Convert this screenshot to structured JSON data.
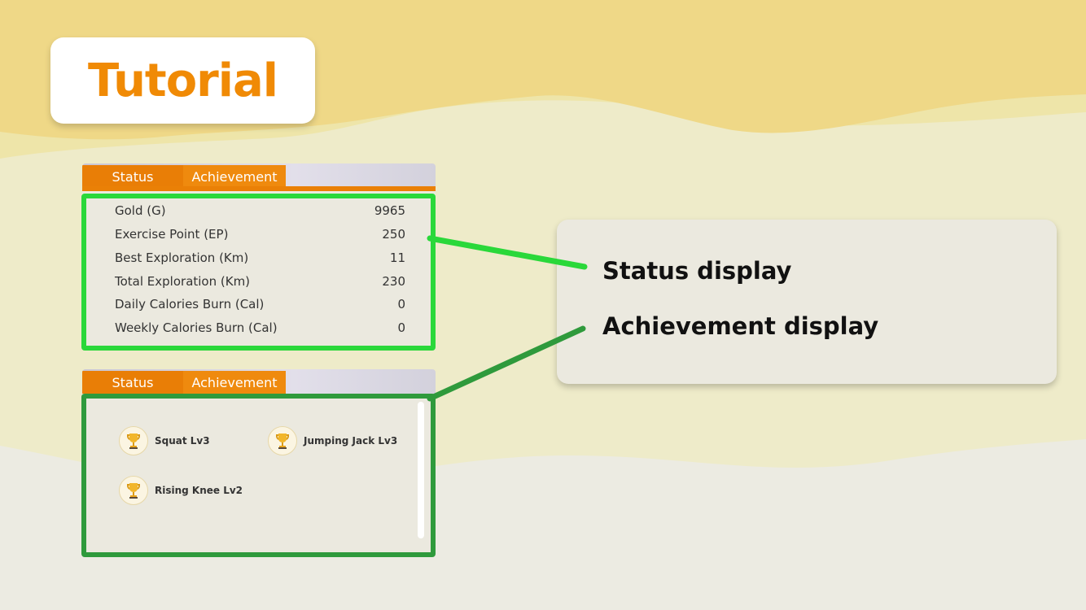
{
  "title": "Tutorial",
  "colors": {
    "title_orange": "#f08a05",
    "tab_orange": "#e97e06",
    "highlight_bright_green": "#2ad83a",
    "highlight_dark_green": "#2f9a3c",
    "panel_bg": "#ebe9df",
    "bg_top_yellow": "#efd887"
  },
  "status_panel": {
    "tabs": [
      "Status",
      "Achievement"
    ],
    "rows": [
      {
        "label": "Gold (G)",
        "value": "9965"
      },
      {
        "label": "Exercise Point (EP)",
        "value": "250"
      },
      {
        "label": "Best Exploration (Km)",
        "value": "11"
      },
      {
        "label": "Total Exploration (Km)",
        "value": "230"
      },
      {
        "label": "Daily Calories Burn (Cal)",
        "value": "0"
      },
      {
        "label": "Weekly Calories Burn (Cal)",
        "value": "0"
      }
    ]
  },
  "achievement_panel": {
    "tabs": [
      "Status",
      "Achievement"
    ],
    "items": [
      {
        "label": "Squat Lv3",
        "icon": "trophy-icon"
      },
      {
        "label": "Jumping Jack Lv3",
        "icon": "trophy-icon"
      },
      {
        "label": "Rising Knee Lv2",
        "icon": "trophy-icon"
      }
    ]
  },
  "callout": {
    "status_label": "Status display",
    "achievement_label": "Achievement display"
  }
}
